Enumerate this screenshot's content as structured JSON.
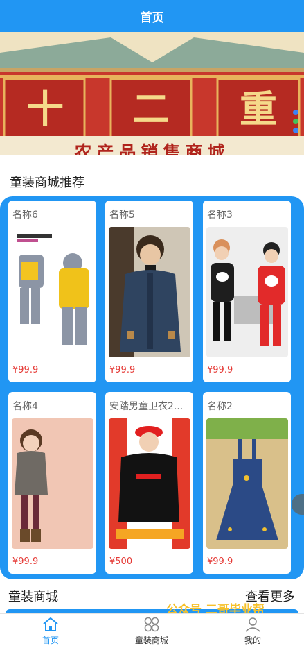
{
  "header": {
    "title": "首页"
  },
  "banner": {
    "chars": [
      "十",
      "二",
      "重"
    ],
    "subtitle": "农产品销售商城",
    "dot_colors": [
      "#3b83f6",
      "#43c25a",
      "#3b83f6"
    ]
  },
  "recommend": {
    "title": "童装商城推荐",
    "items": [
      {
        "name": "名称6",
        "price": "¥99.9",
        "image": "kids-clothing-set-yellow"
      },
      {
        "name": "名称5",
        "price": "¥99.9",
        "image": "boy-denim-jacket"
      },
      {
        "name": "名称3",
        "price": "¥99.9",
        "image": "panda-sweatshirt-kids"
      },
      {
        "name": "名称4",
        "price": "¥99.9",
        "image": "girl-floral-hoodie"
      },
      {
        "name": "安踏男童卫衣2...",
        "price": "¥500",
        "image": "boy-black-sweatshirt-red-cap"
      },
      {
        "name": "名称2",
        "price": "¥99.9",
        "image": "denim-overall-dress"
      }
    ]
  },
  "section2": {
    "title": "童装商城",
    "more": "查看更多"
  },
  "watermark": "公众号 二哥毕业帮",
  "tabs": [
    {
      "label": "首页",
      "icon": "home-icon"
    },
    {
      "label": "童装商城",
      "icon": "grid-icon"
    },
    {
      "label": "我的",
      "icon": "user-icon"
    }
  ],
  "colors": {
    "primary": "#2196f3",
    "price": "#e53935",
    "banner_red": "#b0241c"
  }
}
